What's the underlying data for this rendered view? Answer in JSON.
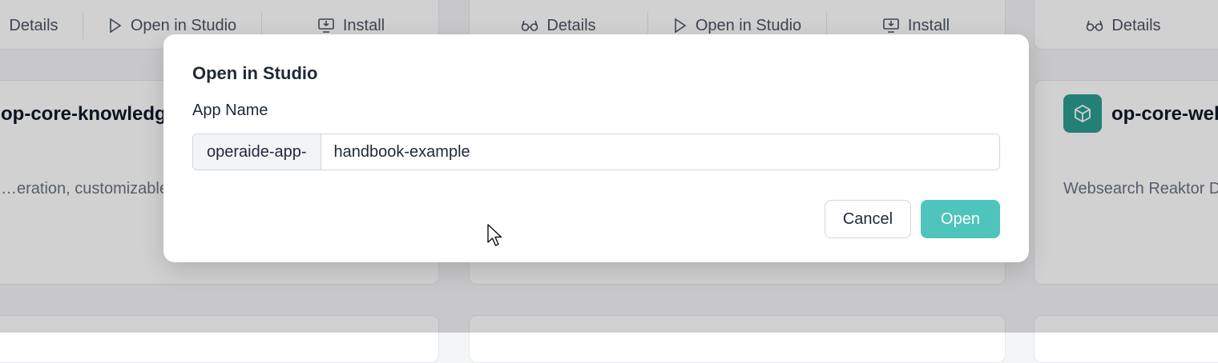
{
  "background": {
    "top_actions": [
      {
        "icon": "glasses-icon",
        "label": "Details"
      },
      {
        "icon": "play-icon",
        "label": "Open in Studio"
      },
      {
        "icon": "install-icon",
        "label": "Install"
      }
    ],
    "cards": [
      {
        "title": "op-core-knowledge-…",
        "description": "…eration, customizable…"
      },
      {
        "title": "op-core-web…",
        "description": "Websearch Reaktor D…"
      }
    ]
  },
  "modal": {
    "title": "Open in Studio",
    "field_label": "App Name",
    "prefix": "operaide-app-",
    "app_name_value": "handbook-example",
    "cancel_label": "Cancel",
    "open_label": "Open",
    "accent_color": "#4ec4bd"
  }
}
